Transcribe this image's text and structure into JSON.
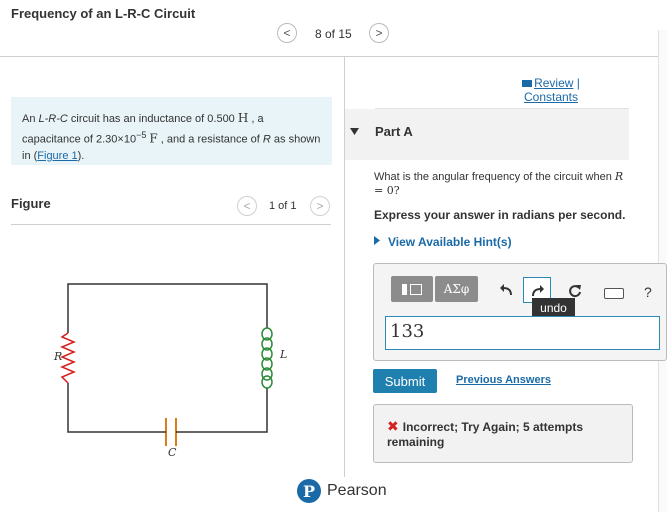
{
  "header": {
    "title": "Frequency of an L-R-C Circuit",
    "pager": "8 of 15",
    "prev_glyph": "<",
    "next_glyph": ">"
  },
  "problem": {
    "t1": "An ",
    "t2": "L-R-C",
    "t3": " circuit has an inductance of 0.500 ",
    "t4": "H",
    "t5": " , a capacitance of 2.30×10",
    "t6": "−5",
    "t7": " ",
    "t8": "F",
    "t9": " , and a resistance of ",
    "t10": "R",
    "t11": " as shown in (",
    "link": "Figure 1",
    "t12": ")."
  },
  "figure": {
    "label": "Figure",
    "pager": "1 of 1",
    "label_R": "R",
    "label_L": "L",
    "label_C": "C",
    "colors": {
      "wire": "#333333",
      "resistor": "#d4201f",
      "inductor": "#2e8b3a",
      "capacitor": "#e07b1a"
    }
  },
  "links": {
    "review": "Review",
    "sep": "|",
    "constants": "Constants"
  },
  "part": {
    "label": "Part A",
    "question_1": "What is the angular frequency of the circuit when ",
    "question_R": "R",
    "question_2": " = 0?",
    "express": "Express your answer in radians per second.",
    "hint": "View Available Hint(s)"
  },
  "toolbar": {
    "templates_icon": "templates-icon",
    "symbols_label": "ΑΣφ",
    "undo_icon": "undo-icon",
    "redo_icon": "redo-icon",
    "reset_icon": "reset-icon",
    "keyboard_icon": "keyboard-icon",
    "help_label": "?",
    "tooltip": "undo"
  },
  "answer": {
    "value": "133"
  },
  "actions": {
    "submit": "Submit",
    "previous": "Previous Answers"
  },
  "feedback": {
    "mark": "✖",
    "text": "Incorrect; Try Again; 5 attempts remaining"
  },
  "brand": {
    "logo_letter": "P",
    "name": "Pearson"
  }
}
